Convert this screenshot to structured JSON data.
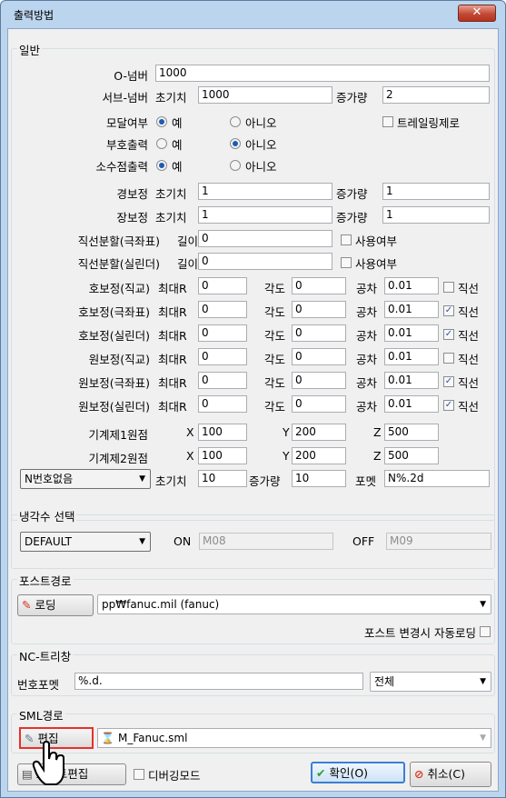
{
  "window": {
    "title": "출력방법",
    "close": "✕"
  },
  "general": {
    "legend": "일반",
    "onum": {
      "label": "O-넘버",
      "value": "1000"
    },
    "subnum": {
      "label": "서브-넘버",
      "init_label": "초기치",
      "init": "1000",
      "inc_label": "증가량",
      "inc": "2"
    },
    "modal": {
      "label": "모달여부",
      "yes": "예",
      "no": "아니오",
      "selected": "yes",
      "trailing_zero_label": "트레일링제로",
      "trailing_zero": false
    },
    "sign": {
      "label": "부호출력",
      "yes": "예",
      "no": "아니오",
      "selected": "no"
    },
    "decimal": {
      "label": "소수점출력",
      "yes": "예",
      "no": "아니오",
      "selected": "yes"
    },
    "light": {
      "label": "경보정",
      "init_label": "초기치",
      "init": "1",
      "inc_label": "증가량",
      "inc": "1"
    },
    "long": {
      "label": "장보정",
      "init_label": "초기치",
      "init": "1",
      "inc_label": "증가량",
      "inc": "1"
    },
    "seg_polar": {
      "label": "직선분할(극좌표)",
      "len_label": "길이",
      "len": "0",
      "use_label": "사용여부",
      "use": false
    },
    "seg_cyl": {
      "label": "직선분할(실린더)",
      "len_label": "길이",
      "len": "0",
      "use_label": "사용여부",
      "use": false
    },
    "comp_rows": [
      {
        "label": "호보정(직교)",
        "maxr_label": "최대R",
        "maxr": "0",
        "angle_label": "각도",
        "angle": "0",
        "tol_label": "공차",
        "tol": "0.01",
        "line_label": "직선",
        "line": false
      },
      {
        "label": "호보정(극좌표)",
        "maxr_label": "최대R",
        "maxr": "0",
        "angle_label": "각도",
        "angle": "0",
        "tol_label": "공차",
        "tol": "0.01",
        "line_label": "직선",
        "line": true
      },
      {
        "label": "호보정(실린더)",
        "maxr_label": "최대R",
        "maxr": "0",
        "angle_label": "각도",
        "angle": "0",
        "tol_label": "공차",
        "tol": "0.01",
        "line_label": "직선",
        "line": true
      },
      {
        "label": "원보정(직교)",
        "maxr_label": "최대R",
        "maxr": "0",
        "angle_label": "각도",
        "angle": "0",
        "tol_label": "공차",
        "tol": "0.01",
        "line_label": "직선",
        "line": false
      },
      {
        "label": "원보정(극좌표)",
        "maxr_label": "최대R",
        "maxr": "0",
        "angle_label": "각도",
        "angle": "0",
        "tol_label": "공차",
        "tol": "0.01",
        "line_label": "직선",
        "line": true
      },
      {
        "label": "원보정(실린더)",
        "maxr_label": "최대R",
        "maxr": "0",
        "angle_label": "각도",
        "angle": "0",
        "tol_label": "공차",
        "tol": "0.01",
        "line_label": "직선",
        "line": true
      }
    ],
    "origin1": {
      "label": "기계제1원점",
      "x_label": "X",
      "x": "100",
      "y_label": "Y",
      "y": "200",
      "z_label": "Z",
      "z": "500"
    },
    "origin2": {
      "label": "기계제2원점",
      "x_label": "X",
      "x": "100",
      "y_label": "Y",
      "y": "200",
      "z_label": "Z",
      "z": "500"
    },
    "nmode": {
      "selected": "N번호없음",
      "init_label": "초기치",
      "init": "10",
      "inc_label": "증가량",
      "inc": "10",
      "format_label": "포멧",
      "format": "N%.2d"
    }
  },
  "coolant": {
    "legend": "냉각수 선택",
    "selected": "DEFAULT",
    "on_label": "ON",
    "on": "M08",
    "off_label": "OFF",
    "off": "M09"
  },
  "post": {
    "legend": "포스트경로",
    "load_label": "로딩",
    "path": "pp₩fanuc.mil (fanuc)",
    "auto_label": "포스트 변경시 자동로딩",
    "auto": false
  },
  "nc": {
    "legend": "NC-트리창",
    "format_label": "번호포멧",
    "format": "%.d.",
    "scope": "전체"
  },
  "sml": {
    "legend": "SML경로",
    "edit_label": "편집",
    "file": "M_Fanuc.sml"
  },
  "footer": {
    "post_edit_label": "포스트편집",
    "debug_label": "디버깅모드",
    "debug": false,
    "ok_label": "확인(O)",
    "cancel_label": "취소(C)"
  },
  "colors": {
    "highlight": "#e8302a",
    "ok_check": "#2f9e2f",
    "cancel_icon": "#d93b28"
  }
}
